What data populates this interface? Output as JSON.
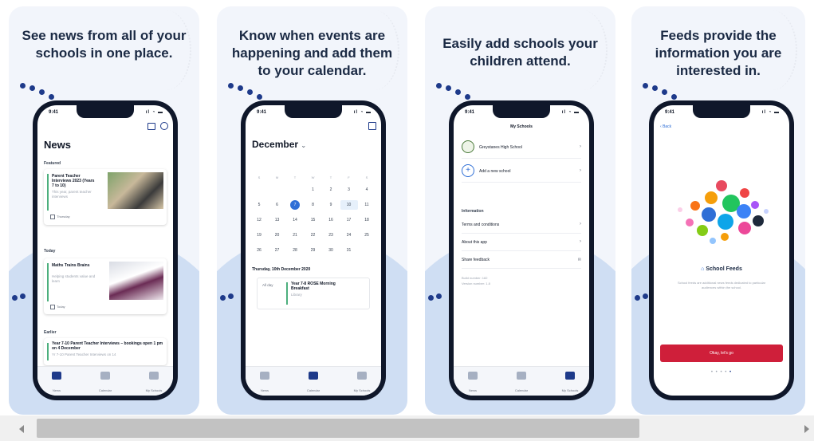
{
  "colors": {
    "accent": "#2f6fd6",
    "green": "#4caf7d",
    "cta": "#cf1f3a",
    "navy": "#1e3a8a",
    "blob": "#cfdef3"
  },
  "status_time": "9:41",
  "status_icons": "ıl ◔ ▬",
  "tabbar": {
    "news": "News",
    "calendar": "Calendar",
    "my_schools": "My Schools"
  },
  "slide1": {
    "headline": "See news from all of your schools in one place.",
    "screen_title": "News",
    "featured_label": "Featured",
    "featured_title": "Parent Teacher Interviews 2023 (Years 7 to 10)",
    "featured_sub": "This year, parent teacher interviews",
    "featured_date": "Thursday",
    "today_label": "Today",
    "today_title": "Maths Trains Brains",
    "today_sub": "Helping students value and learn",
    "today_date": "Today",
    "earlier_label": "Earlier",
    "earlier_title": "Year 7-10 Parent Teacher Interviews – bookings open 1 pm on 4 December",
    "earlier_sub": "Yr 7-10 Parent Teacher Interviews on 14"
  },
  "slide2": {
    "headline": "Know when events are happening and add them to your calendar.",
    "month": "December",
    "weekdays": [
      "S",
      "M",
      "T",
      "W",
      "T",
      "F",
      "S"
    ],
    "weeks": [
      [
        "",
        "",
        "",
        "1",
        "2",
        "3",
        "4"
      ],
      [
        "5",
        "6",
        "7",
        "8",
        "9",
        "10",
        "11"
      ],
      [
        "12",
        "13",
        "14",
        "15",
        "16",
        "17",
        "18"
      ],
      [
        "19",
        "20",
        "21",
        "22",
        "23",
        "24",
        "25"
      ],
      [
        "26",
        "27",
        "28",
        "29",
        "30",
        "31",
        ""
      ]
    ],
    "selected_day": "7",
    "today_day": "10",
    "date_heading": "Thursday, 10th December 2020",
    "event_time": "All day",
    "event_title": "Year 7-8 ROSE Morning Breakfast",
    "event_location": "Library"
  },
  "slide3": {
    "headline": "Easily add schools your children attend.",
    "title": "My Schools",
    "school": "Greystanes High School",
    "add_school": "Add a new school",
    "info_label": "Information",
    "terms": "Terms and conditions",
    "about": "About this app",
    "feedback": "Share feedback",
    "build": "Build number: 182",
    "version": "Version number: 1.8"
  },
  "slide4": {
    "headline": "Feeds provide the information you are interested in.",
    "back": "Back",
    "feed_title": "School Feeds",
    "feed_desc": "School feeds are additional news feeds dedicated to particular audiences within the school.",
    "cta": "Okay, let's go"
  }
}
